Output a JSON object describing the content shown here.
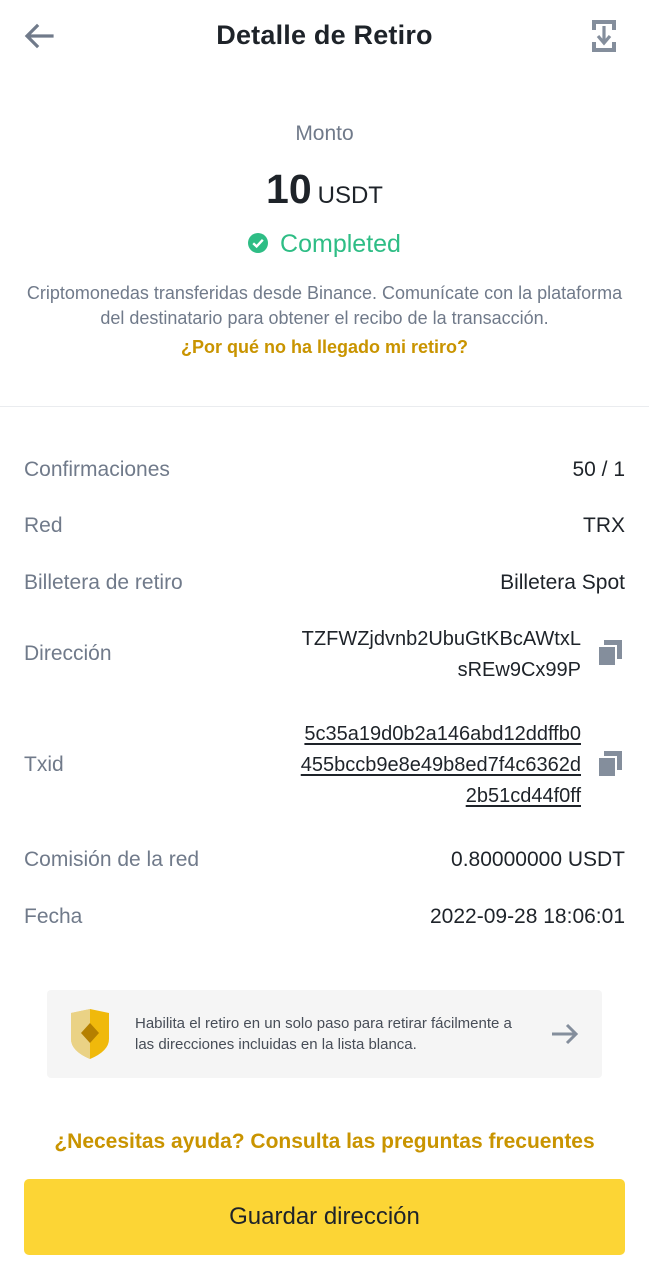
{
  "header": {
    "title": "Detalle de Retiro",
    "back_icon": "back-arrow-icon",
    "share_icon": "share-receipt-icon"
  },
  "summary": {
    "amount_label": "Monto",
    "amount_value": "10",
    "amount_unit": "USDT",
    "status": "Completed",
    "status_icon": "check-circle-icon",
    "description": "Criptomonedas transferidas desde Binance. Comunícate con la plataforma del destinatario para obtener el recibo de la transacción.",
    "why_link": "¿Por qué no ha llegado mi retiro?"
  },
  "details": {
    "confirmations": {
      "label": "Confirmaciones",
      "value": "50 / 1"
    },
    "network": {
      "label": "Red",
      "value": "TRX"
    },
    "wallet": {
      "label": "Billetera de retiro",
      "value": "Billetera Spot"
    },
    "address": {
      "label": "Dirección",
      "line1": "TZFWZjdvnb2UbuGtKBcAWtxL",
      "line2": "sREw9Cx99P"
    },
    "txid": {
      "label": "Txid",
      "line1": "5c35a19d0b2a146abd12ddffb0",
      "line2": "455bccb9e8e49b8ed7f4c6362d",
      "line3": "2b51cd44f0ff"
    },
    "fee": {
      "label": "Comisión de la red",
      "value": "0.80000000 USDT"
    },
    "date": {
      "label": "Fecha",
      "value": "2022-09-28 18:06:01"
    }
  },
  "banner": {
    "text": "Habilita el retiro en un solo paso para retirar fácilmente a las direcciones incluidas en la lista blanca.",
    "icon": "shield-icon",
    "arrow_icon": "arrow-right-icon"
  },
  "help_link": "¿Necesitas ayuda? Consulta las preguntas frecuentes",
  "save_button": "Guardar dirección",
  "colors": {
    "success": "#2ebd85",
    "link_gold": "#c99400",
    "button_yellow": "#fcd535",
    "text_primary": "#1e2329",
    "text_secondary": "#707a8a"
  }
}
